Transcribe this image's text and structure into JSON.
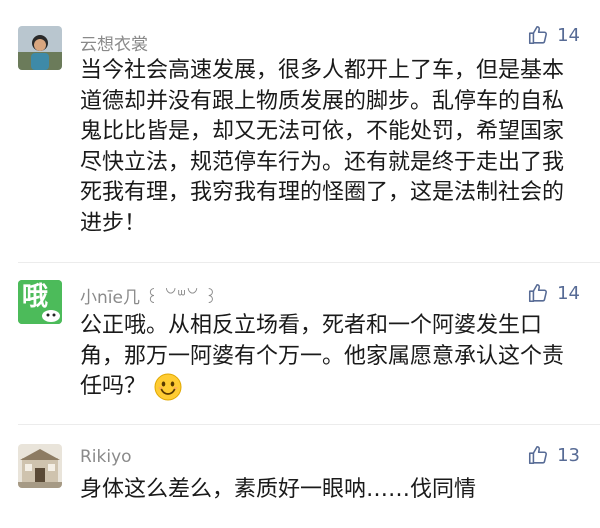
{
  "comments": [
    {
      "user": "云想衣裳",
      "likes": "14",
      "text": "当今社会高速发展，很多人都开上了车，但是基本道德却并没有跟上物质发展的脚步。乱停车的自私鬼比比皆是，却又无法可依，不能处罚，希望国家尽快立法，规范停车行为。还有就是终于走出了我死我有理，我穷我有理的怪圈了，这是法制社会的进步！"
    },
    {
      "user": "小nīe几 ꒰ ꒡ᐜ꒡ ꒱",
      "avatar_text": "哦",
      "likes": "14",
      "text": "公正哦。从相反立场看，死者和一个阿婆发生口角，那万一阿婆有个万一。他家属愿意承认这个责任吗？",
      "emoji": "smile-emoji"
    },
    {
      "user": "Rikiyo",
      "likes": "13",
      "text": "身体这么差么，素质好一眼呐……伐同情"
    }
  ],
  "colors": {
    "like": "#576b95",
    "name": "#8a8a8a",
    "text": "#1a1a1a",
    "avatar2_bg": "#4cbb5a"
  },
  "icons": {
    "like": "thumbs-up-icon"
  }
}
